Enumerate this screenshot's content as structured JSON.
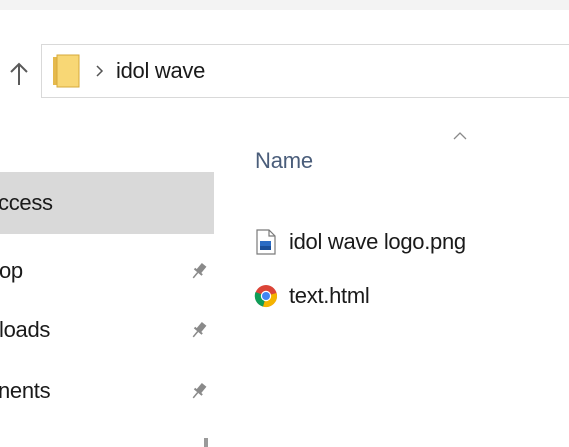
{
  "address_bar": {
    "breadcrumb": [
      "idol wave"
    ]
  },
  "nav_pane": {
    "items": [
      {
        "label": "ccess",
        "pinned": false,
        "selected": true
      },
      {
        "label": "op",
        "pinned": true,
        "selected": false
      },
      {
        "label": "loads",
        "pinned": true,
        "selected": false
      },
      {
        "label": "nents",
        "pinned": true,
        "selected": false
      }
    ]
  },
  "file_list": {
    "column_header": "Name",
    "sort_direction": "ascending",
    "files": [
      {
        "name": "idol wave logo.png",
        "icon": "image-file-icon"
      },
      {
        "name": "text.html",
        "icon": "chrome-html-icon"
      }
    ]
  },
  "colors": {
    "selection": "#d9d9d9",
    "header_text": "#4a5d7a",
    "folder_yellow": "#f8d775",
    "folder_dark": "#e5b94c"
  }
}
